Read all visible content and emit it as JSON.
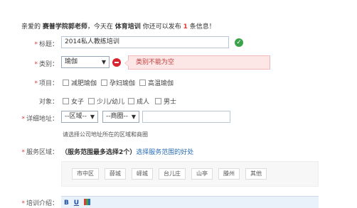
{
  "header": {
    "greeting_prefix": "亲爱的",
    "school_name": "赛普学院郭老师",
    "mid_text": "，今天在",
    "category": "体育培训",
    "remain_text": "你还可以发布",
    "remain_count": "1",
    "suffix": "条信息！"
  },
  "form": {
    "title": {
      "label": "标题：",
      "value": "2014私人教练培训"
    },
    "type": {
      "label": "类别：",
      "value": "瑜伽",
      "error": "类别不能为空"
    },
    "project": {
      "label": "项目：",
      "options": [
        "减肥瑜伽",
        "孕妇瑜伽",
        "高温瑜伽"
      ]
    },
    "audience": {
      "label": "对象：",
      "options": [
        "女子",
        "少儿/幼儿",
        "成人",
        "男士"
      ]
    },
    "address": {
      "label": "详细地址：",
      "city_select": "--区域--",
      "district_select": "--商圈--",
      "hint": "请选择公司地址所在的区域和商圈"
    },
    "service_area": {
      "label": "服务区域：",
      "note": "（服务范围最多选择2个）",
      "link": "选择服务范围的好处",
      "areas": [
        "市中区",
        "薛城",
        "峄城",
        "台儿庄",
        "山亭",
        "滕州",
        "其他"
      ]
    },
    "intro": {
      "label": "培训介绍：",
      "tools": [
        "B",
        "U"
      ]
    }
  },
  "colors": {
    "accent_red": "#e23a3a",
    "ok_green": "#3ca24a",
    "error_red": "#d9242d",
    "link_blue": "#2a6db6"
  }
}
